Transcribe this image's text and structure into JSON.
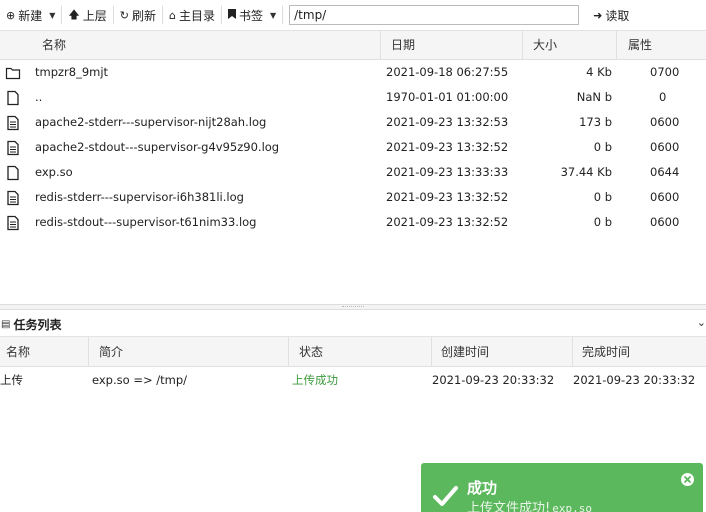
{
  "toolbar": {
    "new_label": "新建",
    "up_label": "上层",
    "refresh_label": "刷新",
    "home_label": "主目录",
    "bookmark_label": "书签",
    "path_value": "/tmp/",
    "read_label": "读取"
  },
  "file_table": {
    "headers": {
      "name": "名称",
      "date": "日期",
      "size": "大小",
      "attr": "属性"
    },
    "rows": [
      {
        "icon": "folder-icon",
        "name": "tmpzr8_9mjt",
        "date": "2021-09-18 06:27:55",
        "size": "4 Kb",
        "attr": "0700"
      },
      {
        "icon": "file-icon",
        "name": "..",
        "date": "1970-01-01 01:00:00",
        "size": "NaN b",
        "attr": "0"
      },
      {
        "icon": "text-file-icon",
        "name": "apache2-stderr---supervisor-nijt28ah.log",
        "date": "2021-09-23 13:32:53",
        "size": "173 b",
        "attr": "0600"
      },
      {
        "icon": "text-file-icon",
        "name": "apache2-stdout---supervisor-g4v95z90.log",
        "date": "2021-09-23 13:32:52",
        "size": "0 b",
        "attr": "0600"
      },
      {
        "icon": "file-icon",
        "name": "exp.so",
        "date": "2021-09-23 13:33:33",
        "size": "37.44 Kb",
        "attr": "0644"
      },
      {
        "icon": "text-file-icon",
        "name": "redis-stderr---supervisor-i6h381li.log",
        "date": "2021-09-23 13:32:52",
        "size": "0 b",
        "attr": "0600"
      },
      {
        "icon": "text-file-icon",
        "name": "redis-stdout---supervisor-t61nim33.log",
        "date": "2021-09-23 13:32:52",
        "size": "0 b",
        "attr": "0600"
      }
    ]
  },
  "task_panel": {
    "title": "任务列表",
    "headers": {
      "name": "名称",
      "desc": "简介",
      "status": "状态",
      "created": "创建时间",
      "finished": "完成时间"
    },
    "rows": [
      {
        "name": "上传",
        "desc": "exp.so => /tmp/",
        "status": "上传成功",
        "created": "2021-09-23 20:33:32",
        "finished": "2021-09-23 20:33:32"
      }
    ]
  },
  "toast": {
    "title": "成功",
    "message": "上传文件成功!",
    "filename": "exp.so"
  },
  "colors": {
    "success_green": "#5cb85c",
    "status_text_green": "#3c9a3c"
  }
}
